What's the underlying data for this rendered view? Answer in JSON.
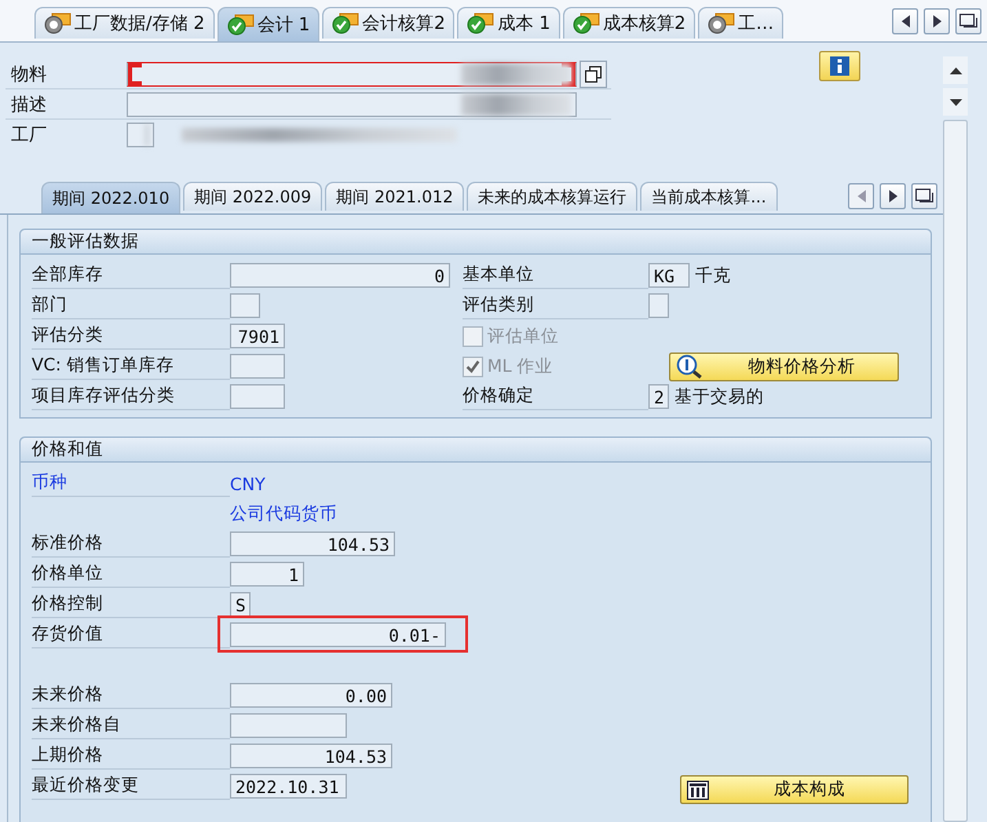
{
  "top_tabs": [
    {
      "label": "工厂数据/存储 2",
      "kind": "radio",
      "selected": false
    },
    {
      "label": "会计 1",
      "kind": "check",
      "selected": true
    },
    {
      "label": "会计核算2",
      "kind": "check",
      "selected": false
    },
    {
      "label": "成本 1",
      "kind": "check",
      "selected": false
    },
    {
      "label": "成本核算2",
      "kind": "check",
      "selected": false
    },
    {
      "label": "工…",
      "kind": "radio",
      "selected": false
    }
  ],
  "header": {
    "fields": [
      {
        "label": "物料",
        "focused": true,
        "blurred": true
      },
      {
        "label": "描述",
        "focused": false,
        "blurred": true
      },
      {
        "label": "工厂",
        "focused": false,
        "blurred": true
      }
    ]
  },
  "period_tabs": [
    {
      "label": "期间 2022.010",
      "selected": true
    },
    {
      "label": "期间 2022.009",
      "selected": false
    },
    {
      "label": "期间 2021.012",
      "selected": false
    },
    {
      "label": "未来的成本核算运行",
      "selected": false
    },
    {
      "label": "当前成本核算...",
      "selected": false
    }
  ],
  "general": {
    "title": "一般评估数据",
    "left": [
      {
        "label": "全部库存",
        "value": "0"
      },
      {
        "label": "部门"
      },
      {
        "label": "评估分类",
        "value": "7901"
      },
      {
        "label": "VC: 销售订单库存"
      },
      {
        "label": "项目库存评估分类"
      }
    ],
    "right": [
      {
        "kind": "field",
        "label": "基本单位",
        "value": "KG",
        "note": "千克"
      },
      {
        "kind": "field",
        "label": "评估类别"
      },
      {
        "kind": "checkbox",
        "label": "评估单位",
        "checked": false,
        "disabled": true
      },
      {
        "kind": "checkbox",
        "label": "ML 作业",
        "checked": true,
        "disabled": true
      },
      {
        "kind": "field",
        "label": "价格确定",
        "value": "2",
        "note": "基于交易的"
      }
    ],
    "button": "物料价格分析"
  },
  "prices": {
    "title": "价格和值",
    "rows": [
      {
        "kind": "link",
        "label": "币种",
        "value": "CNY"
      },
      {
        "kind": "link",
        "value": "公司代码货币"
      },
      {
        "kind": "field",
        "label": "标准价格",
        "value": "104.53"
      },
      {
        "kind": "field",
        "label": "价格单位",
        "value": "1"
      },
      {
        "kind": "field",
        "label": "价格控制",
        "value": "S"
      },
      {
        "kind": "field",
        "label": "存货价值",
        "value": "0.01-",
        "highlighted": true
      },
      {
        "kind": "field",
        "label": "未来价格",
        "value": "0.00",
        "gap_before": true
      },
      {
        "kind": "field",
        "label": "未来价格自"
      },
      {
        "kind": "field",
        "label": "上期价格",
        "value": "104.53"
      },
      {
        "kind": "field",
        "label": "最近价格变更",
        "value": "2022.10.31"
      }
    ],
    "button": "成本构成"
  }
}
